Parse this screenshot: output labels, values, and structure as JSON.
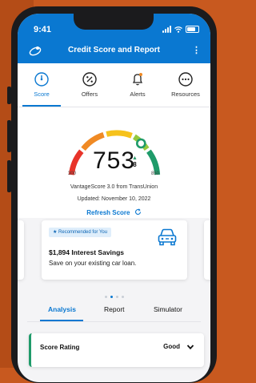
{
  "status_bar": {
    "time": "9:41"
  },
  "header": {
    "title": "Credit Score and Report",
    "more_label": "⋮"
  },
  "tabs": [
    {
      "label": "Score",
      "icon": "score-icon",
      "active": true
    },
    {
      "label": "Offers",
      "icon": "percent-icon",
      "active": false
    },
    {
      "label": "Alerts",
      "icon": "bell-icon",
      "active": false
    },
    {
      "label": "Resources",
      "icon": "more-circle-icon",
      "active": false
    }
  ],
  "score": {
    "value": "753",
    "change": "8",
    "range_min": "300",
    "range_max": "850",
    "provider": "VantageScore 3.0 from TransUnion",
    "updated": "Updated: November 10, 2022",
    "refresh_label": "Refresh Score"
  },
  "offer_card": {
    "badge": "★ Recommended for You",
    "headline": "$1,894 Interest Savings",
    "subtext": "Save on your existing car loan.",
    "icon": "car-icon"
  },
  "carousel": {
    "count": 4,
    "active_index": 1
  },
  "subtabs": [
    "Analysis",
    "Report",
    "Simulator"
  ],
  "rating": {
    "label": "Score Rating",
    "value": "Good"
  },
  "colors": {
    "brand_blue": "#0a78d1",
    "background_orange": "#c8591f",
    "gauge": [
      "#e8342a",
      "#f08a24",
      "#f6c21c",
      "#95c93d",
      "#1f9b6a"
    ]
  }
}
